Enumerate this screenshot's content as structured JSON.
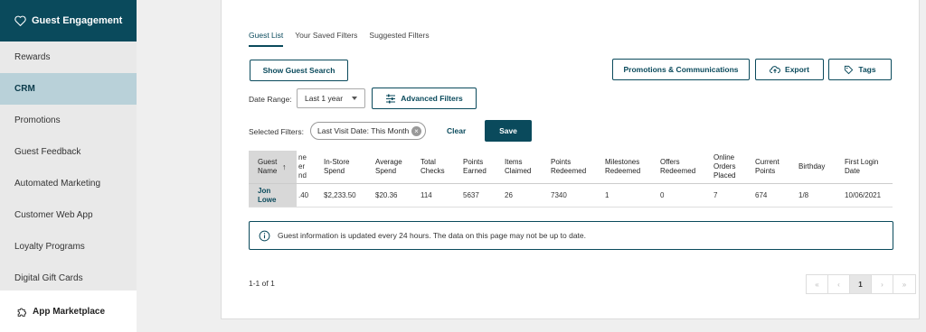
{
  "sidebar": {
    "header": "Guest Engagement",
    "items": [
      {
        "label": "Rewards"
      },
      {
        "label": "CRM"
      },
      {
        "label": "Promotions"
      },
      {
        "label": "Guest Feedback"
      },
      {
        "label": "Automated Marketing"
      },
      {
        "label": "Customer Web App"
      },
      {
        "label": "Loyalty Programs"
      },
      {
        "label": "Digital Gift Cards"
      }
    ],
    "active_item": "CRM",
    "marketplace": "App Marketplace"
  },
  "tabs": [
    {
      "label": "Guest List"
    },
    {
      "label": "Your Saved Filters"
    },
    {
      "label": "Suggested Filters"
    }
  ],
  "active_tab": "Guest List",
  "toolbar": {
    "show_search": "Show Guest Search",
    "promotions": "Promotions & Communications",
    "export": "Export",
    "tags": "Tags"
  },
  "filters": {
    "date_range_label": "Date Range:",
    "date_range_value": "Last 1 year",
    "advanced": "Advanced Filters",
    "selected_label": "Selected Filters:",
    "chip": "Last Visit Date: This Month",
    "clear": "Clear",
    "save": "Save"
  },
  "table": {
    "headers": {
      "guest_name": "Guest Name",
      "online_spend_clipped": "ne er nd",
      "instore": "In-Store Spend",
      "avg": "Average Spend",
      "checks": "Total Checks",
      "earned": "Points Earned",
      "items": "Items Claimed",
      "redeemed": "Points Redeemed",
      "milestones": "Milestones Redeemed",
      "offers": "Offers Redeemed",
      "online_orders": "Online Orders Placed",
      "current": "Current Points",
      "birthday": "Birthday",
      "first_login": "First Login Date"
    },
    "rows": [
      {
        "guest_name": "Jon Lowe",
        "online_spend_clipped": ".40",
        "instore": "$2,233.50",
        "avg": "$20.36",
        "checks": "114",
        "earned": "5637",
        "items": "26",
        "redeemed": "7340",
        "milestones": "1",
        "offers": "0",
        "online_orders": "7",
        "current": "674",
        "birthday": "1/8",
        "first_login": "10/06/2021"
      }
    ]
  },
  "info_message": "Guest information is updated every 24 hours. The data on this page may not be up to date.",
  "pagination": {
    "summary": "1-1 of 1",
    "current_page": "1"
  },
  "colors": {
    "brand": "#0a4a5c",
    "active_sidebar": "#b9d1d9"
  }
}
